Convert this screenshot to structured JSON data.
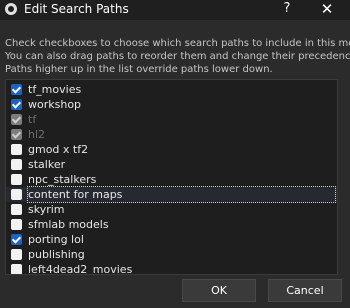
{
  "window": {
    "title": "Edit Search Paths",
    "help_label": "?",
    "close_label": "✕",
    "app_icon": "app-icon"
  },
  "instructions": [
    "Check checkboxes to choose which search paths to include in this mod.",
    "You can also drag paths to reorder them and change their precedence.",
    "Paths higher up in the list override paths lower down."
  ],
  "paths": [
    {
      "label": "tf_movies",
      "checked": true,
      "disabled": false
    },
    {
      "label": "workshop",
      "checked": true,
      "disabled": false
    },
    {
      "label": "tf",
      "checked": true,
      "disabled": true
    },
    {
      "label": "hl2",
      "checked": true,
      "disabled": true
    },
    {
      "label": "gmod x tf2",
      "checked": false,
      "disabled": false
    },
    {
      "label": "stalker",
      "checked": false,
      "disabled": false
    },
    {
      "label": "npc_stalkers",
      "checked": false,
      "disabled": false
    },
    {
      "label": "content for maps",
      "checked": false,
      "disabled": false,
      "selected": true
    },
    {
      "label": "skyrim",
      "checked": false,
      "disabled": false
    },
    {
      "label": "sfmlab models",
      "checked": false,
      "disabled": false
    },
    {
      "label": "porting lol",
      "checked": true,
      "disabled": false
    },
    {
      "label": "publishing",
      "checked": false,
      "disabled": false
    },
    {
      "label": "left4dead2_movies",
      "checked": false,
      "disabled": false
    }
  ],
  "buttons": {
    "ok_label": "OK",
    "cancel_label": "Cancel"
  },
  "colors": {
    "background": "#2b2b2b",
    "list_background": "#1e1e1e",
    "checkbox_checked": "#1a64c8",
    "checkbox_disabled": "#7d7d7d"
  }
}
